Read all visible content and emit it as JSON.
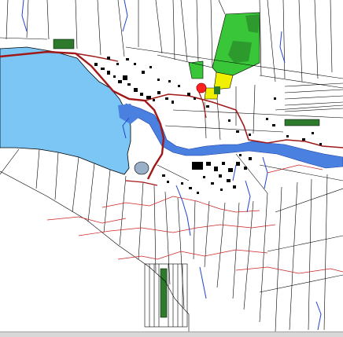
{
  "map": {
    "type": "cadastral-topographic",
    "labels": [],
    "colors": {
      "background": "#ffffff",
      "parcel_line": "#000000",
      "lake": "#7cc6f6",
      "river": "#4a80e0",
      "stream": "#2244cc",
      "road": "#a01818",
      "contour": "#cc2222",
      "forest": "#2d7a2d",
      "field_green": "#39c639",
      "field_yellow": "#f0f000",
      "marker": "#ff2020",
      "building": "#000000",
      "ui_bar": "#d8d8d8"
    },
    "features": {
      "lake": "lake",
      "river": "river",
      "main_road": "main-road",
      "marker": "location-marker"
    }
  }
}
